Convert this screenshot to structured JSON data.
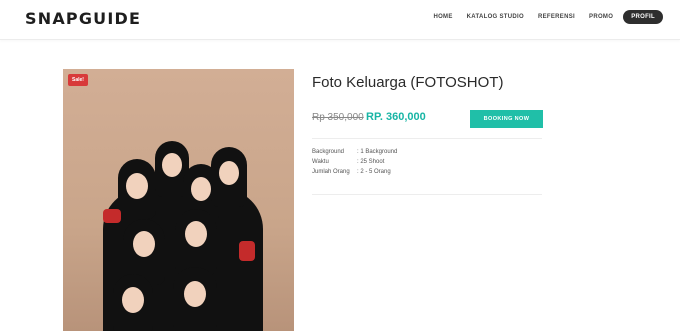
{
  "header": {
    "logo": "SNAPGUIDE",
    "nav": [
      "HOME",
      "KATALOG STUDIO",
      "REFERENSI",
      "PROMO"
    ],
    "profile_label": "PROFIL"
  },
  "product": {
    "sale_badge": "Sale!",
    "title": "Foto Keluarga (FOTOSHOT)",
    "price_old": "Rp 350,000",
    "price_new": "RP. 360,000",
    "booking_label": "BOOKING NOW",
    "details": [
      {
        "label": "Background",
        "value": ": 1 Background"
      },
      {
        "label": "Waktu",
        "value": ": 25 Shoot"
      },
      {
        "label": "Jumlah Orang",
        "value": ": 2 - 5 Orang"
      }
    ]
  },
  "colors": {
    "accent": "#20bfa8",
    "price": "#18b5a5",
    "sale": "#d83a3a",
    "nav_pill": "#2e2e2e"
  }
}
